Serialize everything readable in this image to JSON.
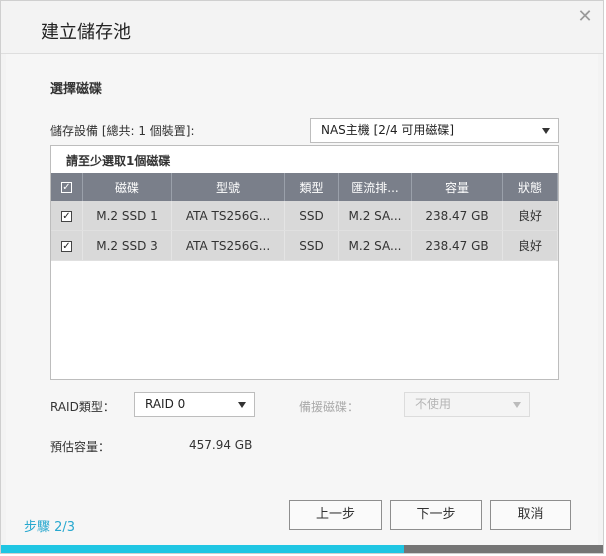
{
  "dialog": {
    "title": "建立儲存池",
    "close_icon": "close-icon"
  },
  "section": {
    "title": "選擇磁碟"
  },
  "storage": {
    "label": "儲存設備 [總共: 1 個裝置]:",
    "selected": "NAS主機 [2/4 可用磁碟]"
  },
  "disks": {
    "hint": "請至少選取1個磁碟",
    "columns": [
      "磁碟",
      "型號",
      "類型",
      "匯流排...",
      "容量",
      "狀態"
    ],
    "rows": [
      {
        "checked": true,
        "disk": "M.2 SSD 1",
        "model": "ATA TS256G...",
        "type": "SSD",
        "bus": "M.2 SA...",
        "capacity": "238.47 GB",
        "status": "良好"
      },
      {
        "checked": true,
        "disk": "M.2 SSD 3",
        "model": "ATA TS256G...",
        "type": "SSD",
        "bus": "M.2 SA...",
        "capacity": "238.47 GB",
        "status": "良好"
      }
    ]
  },
  "raid": {
    "label": "RAID類型：",
    "selected": "RAID 0"
  },
  "spare": {
    "label": "備援磁碟：",
    "selected": "不使用"
  },
  "capacity": {
    "label": "預估容量：",
    "value": "457.94 GB"
  },
  "footer": {
    "step": "步驟 2/3",
    "prev_label": "上一步",
    "next_label": "下一步",
    "cancel_label": "取消",
    "progress": 0.67
  },
  "colors": {
    "accent": "#1fc6e3",
    "step_text": "#27a8cf",
    "header_bg": "#7a7f8a"
  }
}
